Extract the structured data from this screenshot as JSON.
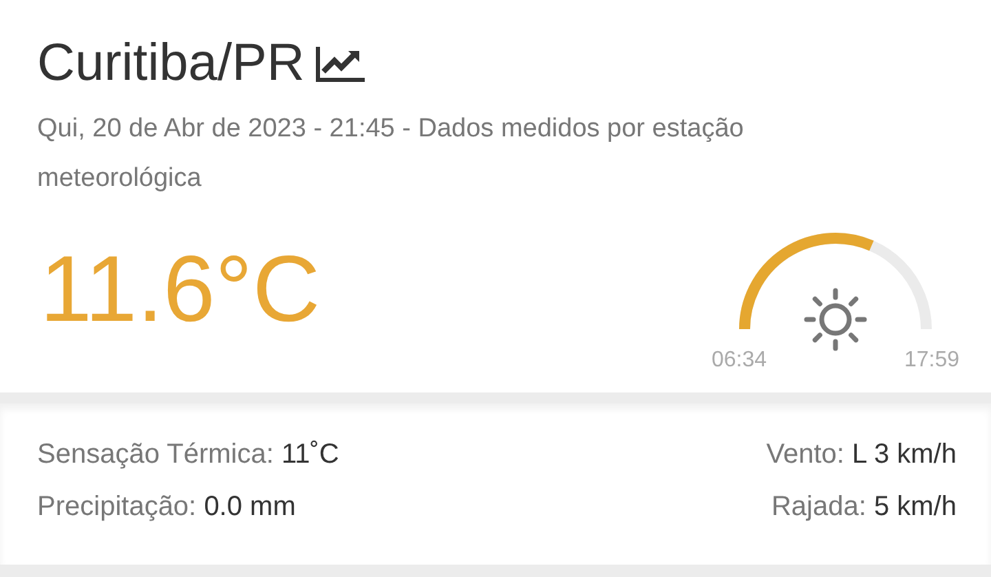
{
  "location": {
    "title": "Curitiba/PR"
  },
  "subtitle": "Qui, 20 de Abr de 2023 - 21:45 - Dados medidos por estação meteorológica",
  "temperature": "11.6°C",
  "sun": {
    "sunrise": "06:34",
    "sunset": "17:59"
  },
  "stats_left": [
    {
      "label": "Sensação Térmica:",
      "value": "11˚C"
    },
    {
      "label": "Precipitação:",
      "value": "0.0 mm"
    }
  ],
  "stats_right": [
    {
      "label": "Vento:",
      "value": "L 3 km/h"
    },
    {
      "label": "Rajada:",
      "value": "5 km/h"
    }
  ]
}
